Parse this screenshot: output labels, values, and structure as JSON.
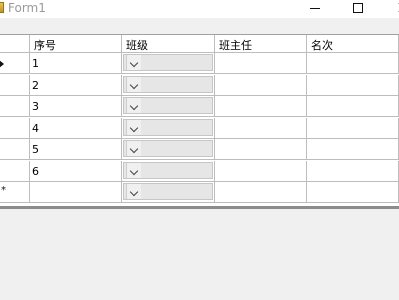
{
  "window": {
    "title": "Form1"
  },
  "grid": {
    "columns": [
      "序号",
      "班级",
      "班主任",
      "名次"
    ],
    "rows": [
      {
        "seq": "1",
        "class": "",
        "teacher": "",
        "rank": ""
      },
      {
        "seq": "2",
        "class": "",
        "teacher": "",
        "rank": ""
      },
      {
        "seq": "3",
        "class": "",
        "teacher": "",
        "rank": ""
      },
      {
        "seq": "4",
        "class": "",
        "teacher": "",
        "rank": ""
      },
      {
        "seq": "5",
        "class": "",
        "teacher": "",
        "rank": ""
      },
      {
        "seq": "6",
        "class": "",
        "teacher": "",
        "rank": ""
      }
    ],
    "new_row_marker": "*"
  }
}
